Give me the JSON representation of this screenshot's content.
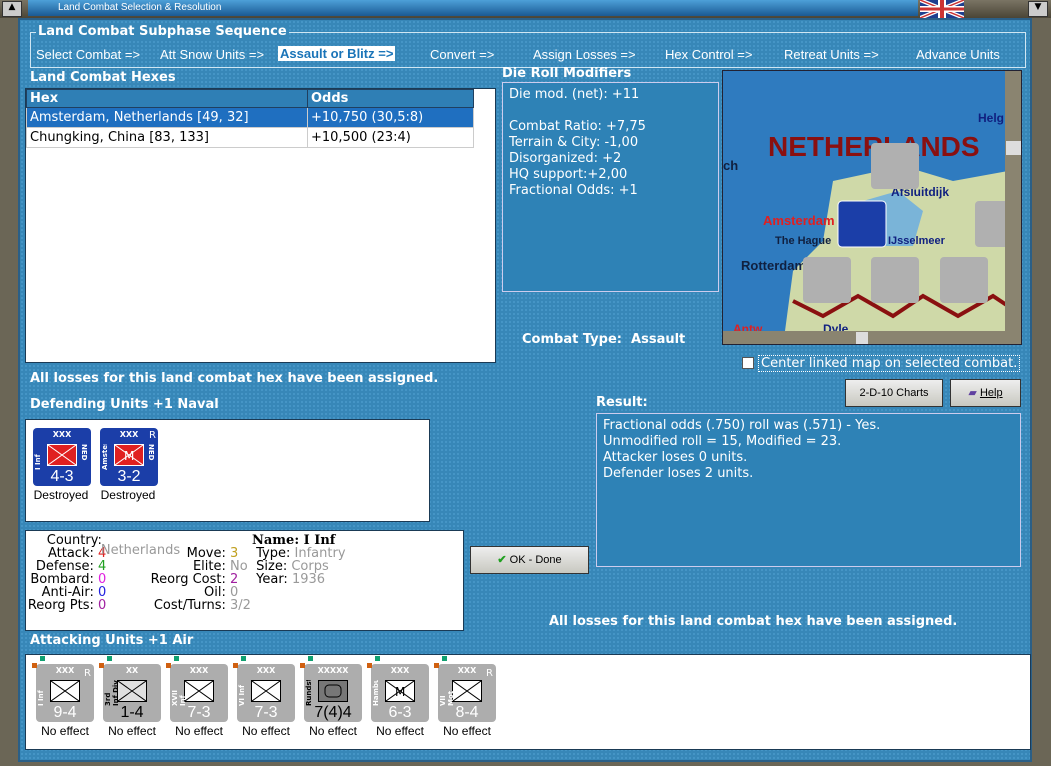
{
  "window": {
    "title": "Land Combat Selection & Resolution"
  },
  "sequence": {
    "title": "Land Combat Subphase Sequence",
    "steps": [
      "Select Combat =>",
      "Att Snow Units =>",
      "Assault or Blitz =>",
      "Convert =>",
      "Assign Losses =>",
      "Hex Control =>",
      "Retreat Units =>",
      "Advance Units"
    ],
    "current": 2
  },
  "hexes": {
    "title": "Land Combat Hexes",
    "columns": [
      "Hex",
      "Odds"
    ],
    "rows": [
      {
        "hex": "Amsterdam, Netherlands [49, 32]",
        "odds": "+10,750 (30,5:8)"
      },
      {
        "hex": "Chungking, China [83, 133]",
        "odds": "+10,500 (23:4)"
      }
    ]
  },
  "die": {
    "title": "Die Roll Modifiers",
    "lines": [
      "Die mod. (net): +11",
      "",
      "Combat Ratio: +7,75",
      "Terrain & City: -1,00",
      "Disorganized: +2",
      "HQ support:+2,00",
      "Fractional Odds: +1"
    ]
  },
  "map": {
    "labels": [
      "NETHERLANDS",
      "Amsterdam",
      "The Hague",
      "Rotterdam",
      "Afsluitdijk",
      "IJsselmeer",
      "Helg",
      "ch",
      "Dyle",
      "Antw"
    ]
  },
  "combat_type": {
    "label": "Combat Type:",
    "value": "Assault"
  },
  "center_map": {
    "label": "Center linked map on selected combat.",
    "checked": false
  },
  "status1": "All losses for this land combat hex have been assigned.",
  "status2": "All losses for this land combat hex have been assigned.",
  "buttons": {
    "charts": "2-D-10 Charts",
    "help": "Help",
    "ok": "OK - Done"
  },
  "defending": {
    "title": "Defending Units +1 Naval",
    "units": [
      {
        "name": "I Inf",
        "size": "XXX",
        "nat": "NED",
        "strength": "4-3",
        "result": "Destroyed",
        "m": ""
      },
      {
        "name": "Amsterdam",
        "size": "XXX",
        "nat": "NED",
        "strength": "3-2",
        "result": "Destroyed",
        "m": "M",
        "r": "R"
      }
    ]
  },
  "result": {
    "title": "Result:",
    "lines": [
      "Fractional odds (.750) roll was (.571)  - Yes.",
      "Unmodified roll = 15, Modified = 23.",
      "Attacker loses 0 units.",
      "Defender loses 2 units."
    ]
  },
  "unit_info": {
    "country": [
      "Country:",
      "Netherlands"
    ],
    "attack": [
      "Attack:",
      "4"
    ],
    "defense": [
      "Defense:",
      "4"
    ],
    "bombard": [
      "Bombard:",
      "0"
    ],
    "antiair": [
      "Anti-Air:",
      "0"
    ],
    "reorgpts": [
      "Reorg Pts:",
      "0"
    ],
    "move": [
      "Move:",
      "3"
    ],
    "elite": [
      "Elite:",
      "No"
    ],
    "reorgcost": [
      "Reorg Cost:",
      "2"
    ],
    "oil": [
      "Oil:",
      "0"
    ],
    "costturns": [
      "Cost/Turns:",
      "3/2"
    ],
    "name": "Name: I Inf",
    "type": [
      "Type:",
      "Infantry"
    ],
    "size": [
      "Size:",
      "Corps"
    ],
    "year": [
      "Year:",
      "1936"
    ]
  },
  "attacking": {
    "title": "Attacking Units +1 Air",
    "units": [
      {
        "name": "I Inf",
        "size": "XXX",
        "strength": "9-4",
        "result": "No effect",
        "r": "R"
      },
      {
        "name": "3rd Inf Div",
        "size": "XX",
        "strength": "1-4",
        "result": "No effect",
        "r": ""
      },
      {
        "name": "XVII Inf",
        "size": "XXX",
        "strength": "7-3",
        "result": "No effect",
        "r": ""
      },
      {
        "name": "VI Inf",
        "size": "XXX",
        "strength": "7-3",
        "result": "No effect",
        "r": ""
      },
      {
        "name": "Rundstedt",
        "size": "XXXXX",
        "strength": "7(4)4",
        "result": "No effect",
        "r": ""
      },
      {
        "name": "Hamburg",
        "size": "XXX",
        "strength": "6-3",
        "result": "No effect",
        "r": ""
      },
      {
        "name": "VII Mot",
        "size": "XXX",
        "strength": "8-4",
        "result": "No effect",
        "r": "R"
      }
    ]
  }
}
